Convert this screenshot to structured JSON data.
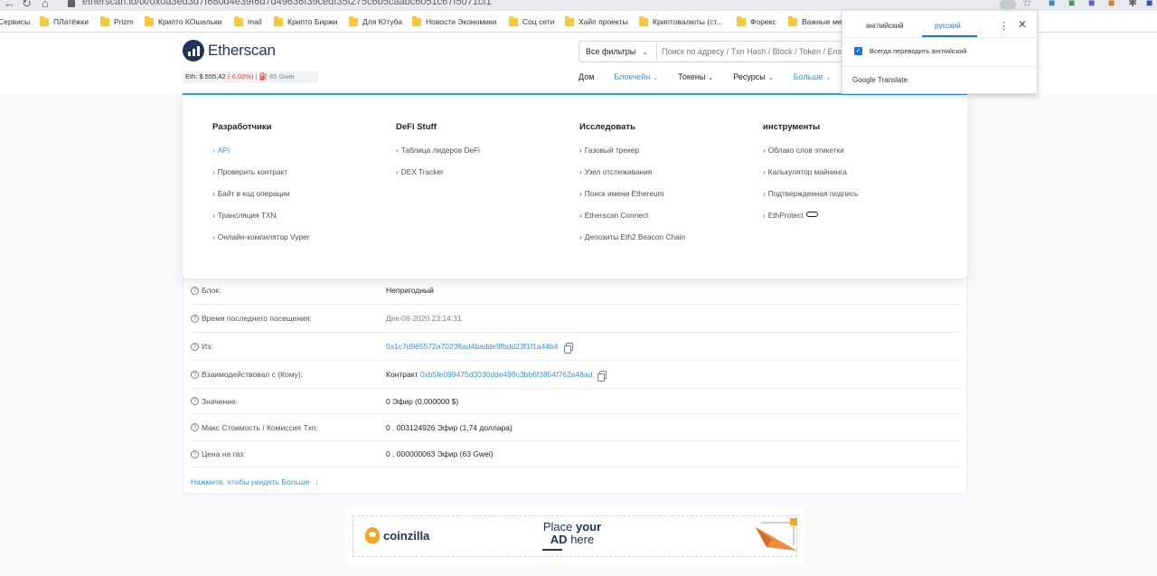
{
  "browser": {
    "nav_back": "←",
    "nav_reload": "↻",
    "nav_home": "⌂",
    "url": "etherscan.io/tx/0x0a3ed3d7f680d4e39f6d7d49636f39cedf35f275c6b5caabc6051c67f5071cf1",
    "bookmarks": [
      "Сервисы",
      "ПЛатёжки",
      "Prizm",
      "Крипто КОшельки",
      "mail",
      "Крипто Биржи",
      "Для Ютуба",
      "Новости Экономики",
      "Соц сети",
      "Хайп проекты",
      "Криптовалюты (ст...",
      "Форекс",
      "Важные ме"
    ]
  },
  "header": {
    "logo_text": "Etherscan",
    "eth_label": "Eth: $ 555,42",
    "eth_change": "(-6,02%)",
    "gas": "| ⛽ 85 Gwei",
    "filter_label": "Все фильтры",
    "search_placeholder": "Поиск по адресу / Txn Hash / Block / Token / Ens",
    "nav": [
      "Дом",
      "Блокчейн",
      "Токены",
      "Ресурсы",
      "Больше"
    ]
  },
  "dropdown": {
    "col1": {
      "title": "Разработчики",
      "links": [
        "API",
        "Проверить контракт",
        "Байт в код операции",
        "Трансляция TXN",
        "Онлайн-компилятор Vyper"
      ]
    },
    "col2": {
      "title": "DeFi Stuff",
      "links": [
        "Таблица лидеров DeFi",
        "DEX Tracker"
      ]
    },
    "col3": {
      "title": "Исследовать",
      "links": [
        "Газовый трекер",
        "Узел отслеживания",
        "Поиск имени Ethereum",
        "Etherscan Connect",
        "Депозиты Eth2 Beacon Chain"
      ]
    },
    "col4": {
      "title": "инструменты",
      "links": [
        "Облако слов этикетки",
        "Калькулятор майнинга",
        "Подтвержденная подпись",
        "EthProtect"
      ]
    }
  },
  "details": {
    "rows": [
      {
        "label": "Блок:",
        "value": "Непригодный"
      },
      {
        "label": "Время последнего посещения:",
        "value": "Дек-08-2020 23:14:31"
      },
      {
        "label": "Из:",
        "value": "0x1c7d965572a70238ad4badde9fbdd23f1f1a44b4"
      },
      {
        "label": "Взаимодействовал с (Кому):",
        "prefix": "Контракт",
        "value": "0xb5fe099475d3030dde498c3bb6f3854f762a48ad"
      },
      {
        "label": "Значение:",
        "value": "0 Эфир (0,000000 $)"
      },
      {
        "label": "Макс Стоимость / Комиссия Txn:",
        "value": "0 . 003124926 Эфир (1,74 доллара)"
      },
      {
        "label": "Цена на газ:",
        "value": "0 . 000000063 Эфир (63 Gwei)"
      }
    ],
    "more": "Нажмите, чтобы увидеть Больше"
  },
  "ad": {
    "brand": "coinzilla",
    "line1_a": "Place",
    "line1_b": "your",
    "line2_a": "AD",
    "line2_b": "here"
  },
  "translate": {
    "lang_from": "английский",
    "lang_to": "русский",
    "always": "Всегда переводить английский",
    "brand": "Google Translate"
  },
  "colors": {
    "accent": "#3498db",
    "brand": "#21325b",
    "negative": "#de4437",
    "google_blue": "#1a73e8"
  }
}
